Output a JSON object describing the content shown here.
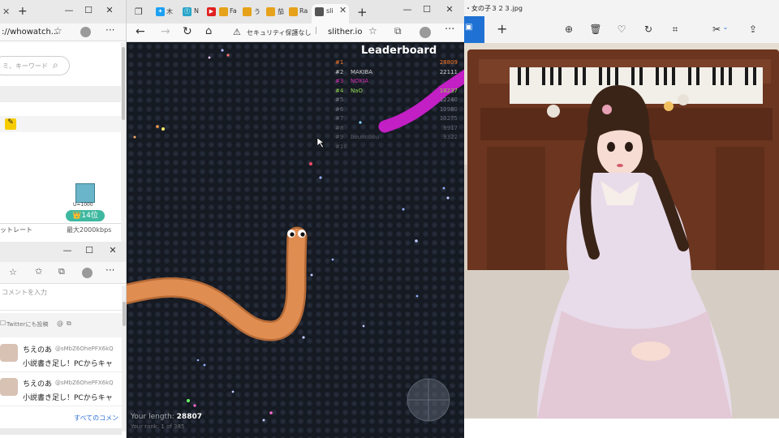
{
  "left_window": {
    "tab_close": "✕",
    "new_tab": "+",
    "min": "—",
    "max": "☐",
    "close": "✕",
    "address": "://whowatch...",
    "search_placeholder": "ミ、キーワード",
    "rank_badge": "👑14位",
    "stat_label_left": "ットレート",
    "stat_label_right": "最大2000kbps",
    "icon_label": "U=1000"
  },
  "left_bottom": {
    "min": "—",
    "max": "☐",
    "close": "✕",
    "comment_placeholder": "コメントを入力",
    "twitter_post": "Twitterにも投稿",
    "at_sign": "@",
    "comments": [
      {
        "name": "ちえのあ",
        "handle": "@sMbZ6OhePFX6kQ",
        "text": "小説書き足し！PCからキャ"
      },
      {
        "name": "ちえのあ",
        "handle": "@sMbZ6OhePFX6kQ",
        "text": "小説書き足し！PCからキャ"
      }
    ],
    "all_comments": "すべてのコメン"
  },
  "browser": {
    "tabs": [
      "木",
      "N",
      "Fa",
      "う",
      "茄",
      "Ra",
      "sl"
    ],
    "active_tab": "sli",
    "new_tab": "+",
    "min": "—",
    "max": "☐",
    "close": "✕",
    "security_text": "セキュリティ保護なし",
    "url": "slither.io"
  },
  "game": {
    "leaderboard_title": "Leaderboard",
    "leaderboard": [
      {
        "rank": "#1",
        "name": "",
        "score": "28809",
        "color": "#ff7a28"
      },
      {
        "rank": "#2",
        "name": "MAKIBA",
        "score": "22111",
        "color": "#d0d0d0"
      },
      {
        "rank": "#3",
        "name": "NOKIA",
        "score": "",
        "color": "#d02fb0"
      },
      {
        "rank": "#4",
        "name": "NaO",
        "score": "18237",
        "color": "#8bd44a"
      },
      {
        "rank": "#5",
        "name": "",
        "score": "12240",
        "color": "#7a7f8a"
      },
      {
        "rank": "#6",
        "name": "",
        "score": "10980",
        "color": "#6f7480"
      },
      {
        "rank": "#7",
        "name": "",
        "score": "10275",
        "color": "#666b76"
      },
      {
        "rank": "#8",
        "name": "",
        "score": "9917",
        "color": "#60656f"
      },
      {
        "rank": "#9",
        "name": "bounobou",
        "score": "9322",
        "color": "#5a5f69"
      },
      {
        "rank": "#10",
        "name": "",
        "score": "",
        "color": "#555a63"
      }
    ],
    "length_label": "Your length:",
    "length_value": "28807",
    "rank_text": "Your rank: 1 of 385"
  },
  "photo_viewer": {
    "title": "・女の子３２３.jpg",
    "add": "+",
    "toolbar_icons": [
      "zoom-in-icon",
      "delete-icon",
      "favorite-icon",
      "rotate-icon",
      "crop-icon",
      "edit-icon",
      "share-icon"
    ]
  },
  "colors": {
    "player_snake": "#d9844a",
    "enemy_snake": "#c21fc4",
    "game_bg": "#161a23",
    "rank_badge": "#3fb8a0"
  }
}
